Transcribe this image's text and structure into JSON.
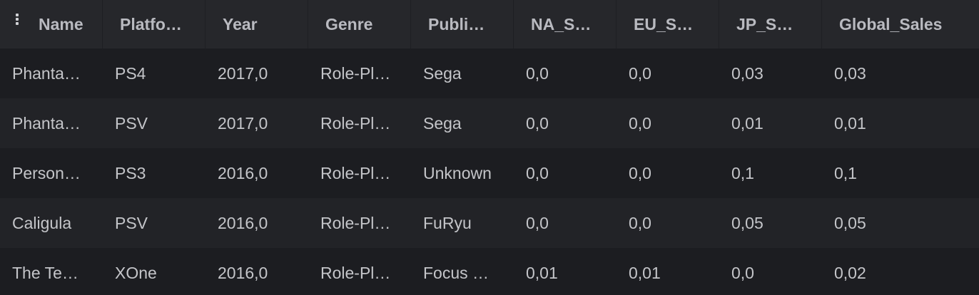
{
  "table": {
    "columns": [
      "Name",
      "Platfo…",
      "Year",
      "Genre",
      "Publi…",
      "NA_S…",
      "EU_S…",
      "JP_S…",
      "Global_Sales"
    ],
    "rows": [
      [
        "Phanta…",
        "PS4",
        "2017,0",
        "Role-Pl…",
        "Sega",
        "0,0",
        "0,0",
        "0,03",
        "0,03"
      ],
      [
        "Phanta…",
        "PSV",
        "2017,0",
        "Role-Pl…",
        "Sega",
        "0,0",
        "0,0",
        "0,01",
        "0,01"
      ],
      [
        "Person…",
        "PS3",
        "2016,0",
        "Role-Pl…",
        "Unknown",
        "0,0",
        "0,0",
        "0,1",
        "0,1"
      ],
      [
        "Caligula",
        "PSV",
        "2016,0",
        "Role-Pl…",
        "FuRyu",
        "0,0",
        "0,0",
        "0,05",
        "0,05"
      ],
      [
        "The Te…",
        "XOne",
        "2016,0",
        "Role-Pl…",
        "Focus …",
        "0,01",
        "0,01",
        "0,0",
        "0,02"
      ]
    ]
  },
  "icons": {
    "column_menu": "vertical-dots-icon"
  },
  "colors": {
    "background": "#1c1d21",
    "header_background": "#26272b",
    "row_alt_background": "#222327",
    "text": "#c4c5c9"
  }
}
